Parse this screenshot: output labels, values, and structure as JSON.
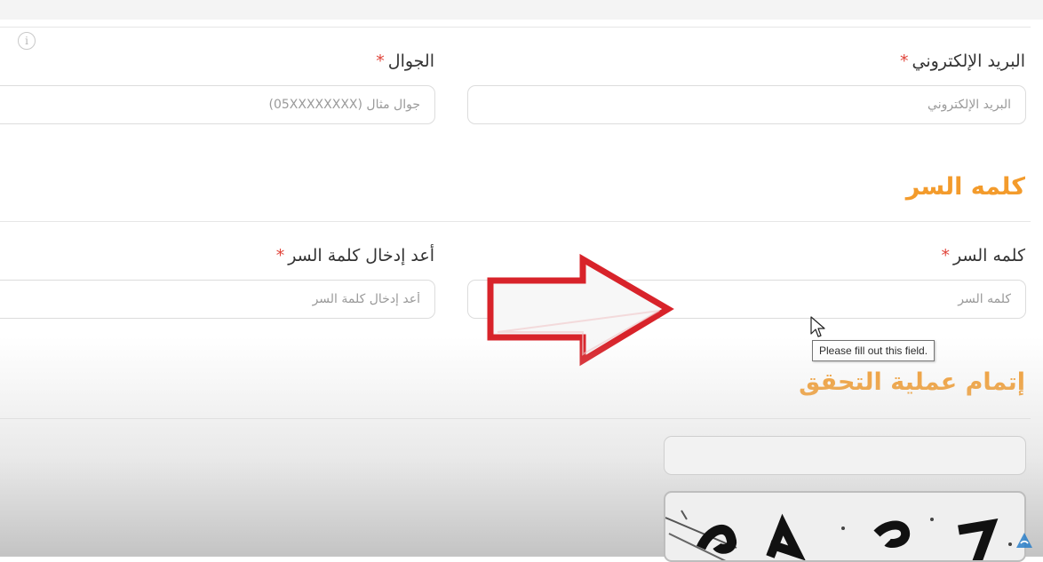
{
  "form": {
    "email": {
      "label": "البريد الإلكتروني",
      "required_mark": "*",
      "placeholder": "البريد الإلكتروني"
    },
    "mobile": {
      "label": "الجوال",
      "required_mark": "*",
      "placeholder": "جوال مثال (05XXXXXXXX)"
    },
    "password_section": {
      "title": "كلمه السر"
    },
    "password": {
      "label": "كلمه السر",
      "required_mark": "*",
      "placeholder": "كلمه السر"
    },
    "confirm_password": {
      "label": "أعد إدخال كلمة السر",
      "required_mark": "*",
      "placeholder": "أعد إدخال كلمة السر"
    },
    "verification_section": {
      "title": "إتمام عملية التحقق"
    },
    "captcha": {
      "input_value": "",
      "image_icon": "captcha-image"
    }
  },
  "tooltip": {
    "text": "Please fill out this field."
  },
  "icons": {
    "info": "info-icon",
    "info_glyph": "i",
    "arrow": "red-arrow-annotation",
    "cursor": "mouse-cursor",
    "logo": "channel-logo-watermark"
  },
  "colors": {
    "accent": "#f39b2c",
    "required": "#e0443a",
    "arrow_red": "#d8232a"
  }
}
